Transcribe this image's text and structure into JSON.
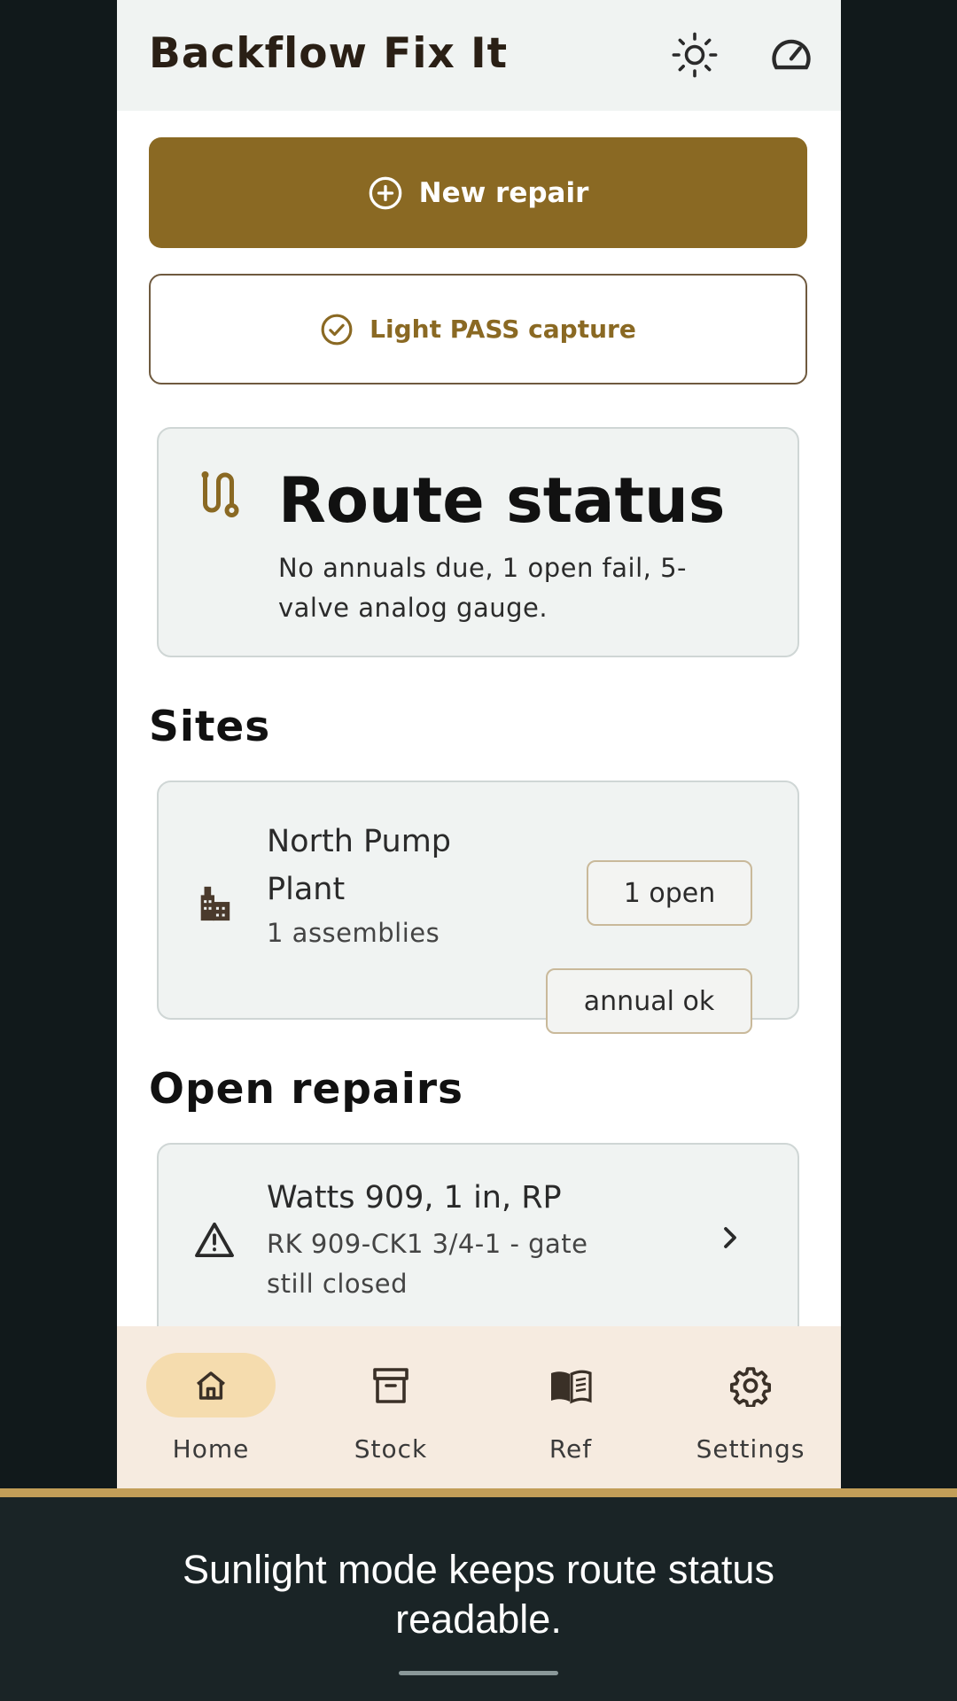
{
  "app": {
    "title": "Backflow Fix It",
    "icons": {
      "theme": "sun-icon",
      "gauge": "gauge-icon"
    }
  },
  "actions": {
    "new_repair": "New repair",
    "light_pass": "Light PASS capture"
  },
  "route_status": {
    "title": "Route status",
    "text": "No annuals due, 1 open fail, 5-valve analog gauge."
  },
  "sites": {
    "heading": "Sites",
    "items": [
      {
        "name": "North Pump Plant",
        "assemblies": "1 assemblies",
        "open_badge": "1 open",
        "annual_badge": "annual ok"
      }
    ]
  },
  "open_repairs": {
    "heading": "Open repairs",
    "items": [
      {
        "title": "Watts 909, 1 in, RP",
        "detail": "RK 909-CK1 3/4-1 - gate still closed"
      }
    ]
  },
  "nav": {
    "items": [
      {
        "label": "Home",
        "icon": "home-icon",
        "active": true
      },
      {
        "label": "Stock",
        "icon": "archive-box-icon",
        "active": false
      },
      {
        "label": "Ref",
        "icon": "book-icon",
        "active": false
      },
      {
        "label": "Settings",
        "icon": "gear-icon",
        "active": false
      }
    ]
  },
  "caption": {
    "text": "Sunlight mode keeps route status readable."
  },
  "colors": {
    "accent": "#8a6923",
    "nav_active": "#f5dcae",
    "nav_background": "#f6ebe0",
    "card_background": "#f0f3f2",
    "caption_rule": "#c29e58"
  }
}
